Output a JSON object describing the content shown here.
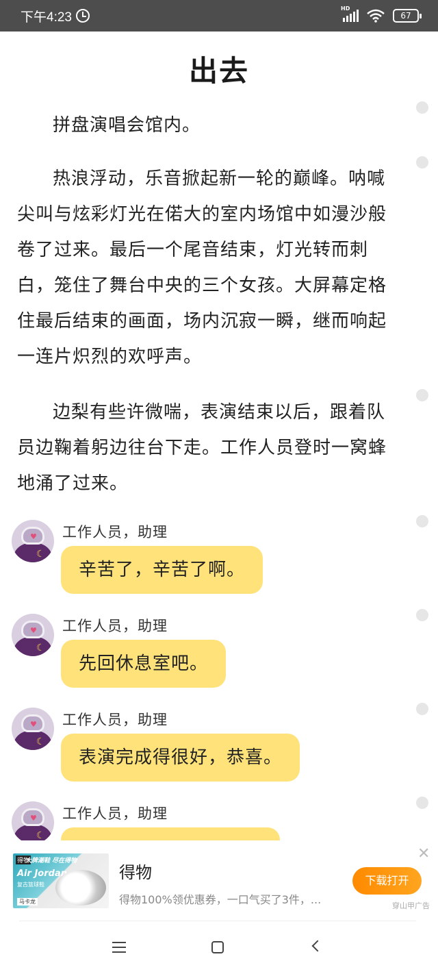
{
  "status_bar": {
    "time": "下午4:23",
    "network": "HD",
    "battery": "67"
  },
  "article": {
    "title": "出去",
    "paragraphs": [
      "拼盘演唱会馆内。",
      "热浪浮动，乐音掀起新一轮的巅峰。呐喊尖叫与炫彩灯光在偌大的室内场馆中如漫沙般卷了过来。最后一个尾音结束，灯光转而刺白，笼住了舞台中央的三个女孩。大屏幕定格住最后结束的画面，场内沉寂一瞬，继而响起一连片炽烈的欢呼声。",
      "边梨有些许微喘，表演结束以后，跟着队员边鞠着躬边往台下走。工作人员登时一窝蜂地涌了过来。"
    ]
  },
  "chat": [
    {
      "speaker": "工作人员，助理",
      "text": "辛苦了，辛苦了啊。"
    },
    {
      "speaker": "工作人员，助理",
      "text": "先回休息室吧。"
    },
    {
      "speaker": "工作人员，助理",
      "text": "表演完成得很好，恭喜。"
    },
    {
      "speaker": "工作人员，助理",
      "text": ""
    }
  ],
  "ad": {
    "image_tag": "得物",
    "image_headline": "大牌潮鞋 尽在得物",
    "image_brand": "Air Jordan",
    "image_sub": "复古篮球鞋",
    "image_caption": "马卡龙",
    "title": "得物",
    "description": "得物100%领优惠券，一口气买了3件，...",
    "button": "下载打开",
    "close": "✕",
    "source": "穿山甲广告"
  },
  "colors": {
    "status_bar": "#4d4d4d",
    "bubble": "#ffe27a",
    "ad_button": "#ff8a00"
  },
  "icons": [
    "alarm-icon",
    "signal-icon",
    "wifi-icon",
    "battery-icon",
    "close-icon",
    "menu-icon",
    "home-icon",
    "back-icon"
  ]
}
